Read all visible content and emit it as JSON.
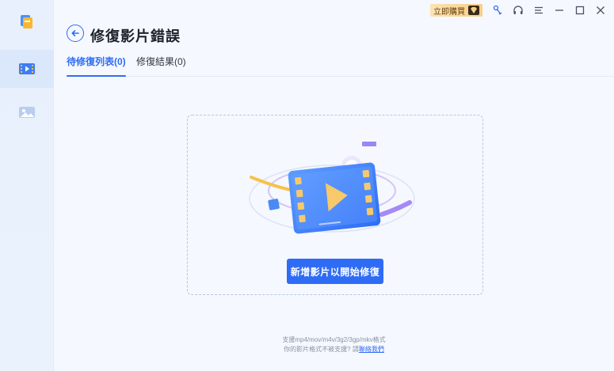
{
  "sidebar": {
    "logo_icon": "app-logo-icon",
    "items": [
      {
        "name": "video-repair",
        "icon": "video-film-icon",
        "active": true
      },
      {
        "name": "photo-repair",
        "icon": "image-icon",
        "active": false
      }
    ]
  },
  "titlebar": {
    "buy_label": "立即購買",
    "buy_icon": "vip-diamond-icon",
    "icons": [
      "broom-icon",
      "headset-icon",
      "menu-icon",
      "minimize-icon",
      "maximize-icon",
      "close-icon"
    ]
  },
  "header": {
    "back_icon": "back-arrow-icon",
    "title": "修復影片錯誤"
  },
  "tabs": [
    {
      "label": "待修復列表",
      "count": "(0)",
      "active": true
    },
    {
      "label": "修復結果",
      "count": "(0)",
      "active": false
    }
  ],
  "dropzone": {
    "illustration": "video-player-icon",
    "add_button": "新增影片以開始修復"
  },
  "footer": {
    "formats": "支援mp4/mov/m4v/3g2/3gp/mkv格式",
    "question": "你的影片格式不被支援? 請",
    "link": "聯絡我們"
  },
  "colors": {
    "accent": "#2f6cf6",
    "sidebar_bg": "#e8f0fd",
    "main_bg": "#f5f8fe",
    "buy_bg": "#f6cf86"
  }
}
